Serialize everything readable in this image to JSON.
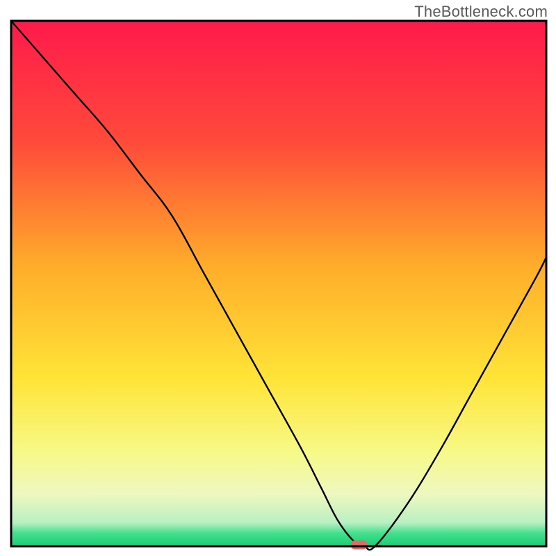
{
  "watermark": "TheBottleneck.com",
  "chart_data": {
    "type": "line",
    "title": "",
    "xlabel": "",
    "ylabel": "",
    "xlim": [
      0,
      100
    ],
    "ylim": [
      0,
      100
    ],
    "grid": false,
    "legend": false,
    "background_gradient_stops": [
      {
        "offset": 0.0,
        "color": "#ff1a4b"
      },
      {
        "offset": 0.23,
        "color": "#ff4a3a"
      },
      {
        "offset": 0.47,
        "color": "#ffae2a"
      },
      {
        "offset": 0.68,
        "color": "#ffe437"
      },
      {
        "offset": 0.82,
        "color": "#f7f987"
      },
      {
        "offset": 0.9,
        "color": "#eef8c0"
      },
      {
        "offset": 0.955,
        "color": "#b9f0c2"
      },
      {
        "offset": 0.975,
        "color": "#43e08e"
      },
      {
        "offset": 1.0,
        "color": "#18ce73"
      }
    ],
    "series": [
      {
        "name": "bottleneck-curve",
        "x": [
          0,
          6,
          12,
          18,
          24,
          30,
          36,
          42,
          48,
          54,
          58,
          61,
          64,
          66,
          68,
          74,
          80,
          86,
          92,
          98,
          100
        ],
        "y": [
          100,
          93,
          86,
          79,
          71,
          63,
          52,
          41,
          30,
          19,
          11,
          5,
          1,
          0,
          0,
          8,
          18,
          29,
          40,
          51,
          55
        ],
        "note": "y is percentage height from the bottom green band (0) to the top (100). Curve descends steeply from top-left, flattens briefly at the bottom near x≈65, then rises toward the right edge."
      }
    ],
    "marker": {
      "name": "selected-point",
      "x": 65,
      "y": 0,
      "color": "#e06a6a",
      "shape": "pill"
    },
    "axes": {
      "frame_color": "#000000",
      "frame_width": 3
    }
  }
}
